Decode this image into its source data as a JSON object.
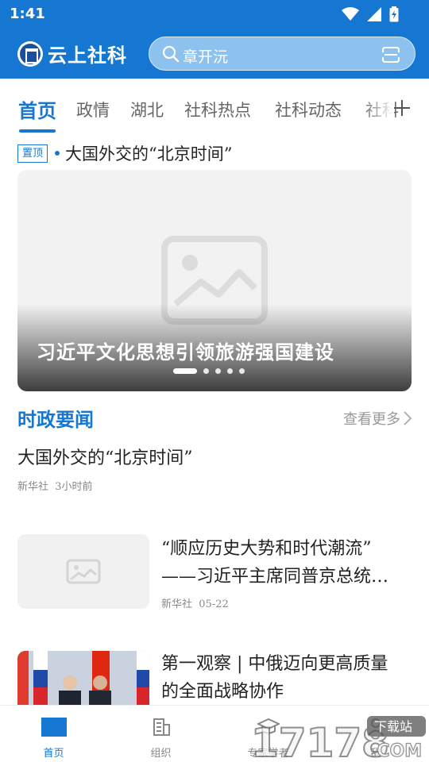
{
  "status_bar": {
    "time": "1:41"
  },
  "header": {
    "app_name": "云上社科",
    "search_text": "章开沅"
  },
  "tabs": [
    {
      "label": "首页",
      "active": true
    },
    {
      "label": "政情"
    },
    {
      "label": "湖北"
    },
    {
      "label": "社科热点"
    },
    {
      "label": "社科动态"
    },
    {
      "label": "社科"
    }
  ],
  "pinned": {
    "badge": "置顶",
    "title": "大国外交的“北京时间”"
  },
  "banner": {
    "title": "习近平文化思想引领旅游强国建设",
    "slide_count": 5,
    "active_slide": 1
  },
  "section": {
    "title": "时政要闻",
    "more": "查看更多"
  },
  "news": [
    {
      "title": "大国外交的“北京时间”",
      "source": "新华社",
      "time": "3小时前"
    },
    {
      "title_line1": "“顺应历史大势和时代潮流”",
      "title_line2": "——习近平主席同普京总统…",
      "source": "新华社",
      "time": "05-22"
    },
    {
      "title_line1": "第一观察 | 中俄迈向更高质量",
      "title_line2": "的全面战略协作"
    }
  ],
  "bottom_nav": [
    {
      "label": "首页",
      "active": true
    },
    {
      "label": "组织"
    },
    {
      "label": "专家学者"
    },
    {
      "label": "我"
    }
  ],
  "watermark": {
    "text": "17178",
    "suffix": ".COM",
    "tag": "下载站"
  },
  "colors": {
    "brand_blue": "#1677d2",
    "text_gray": "#888888"
  }
}
